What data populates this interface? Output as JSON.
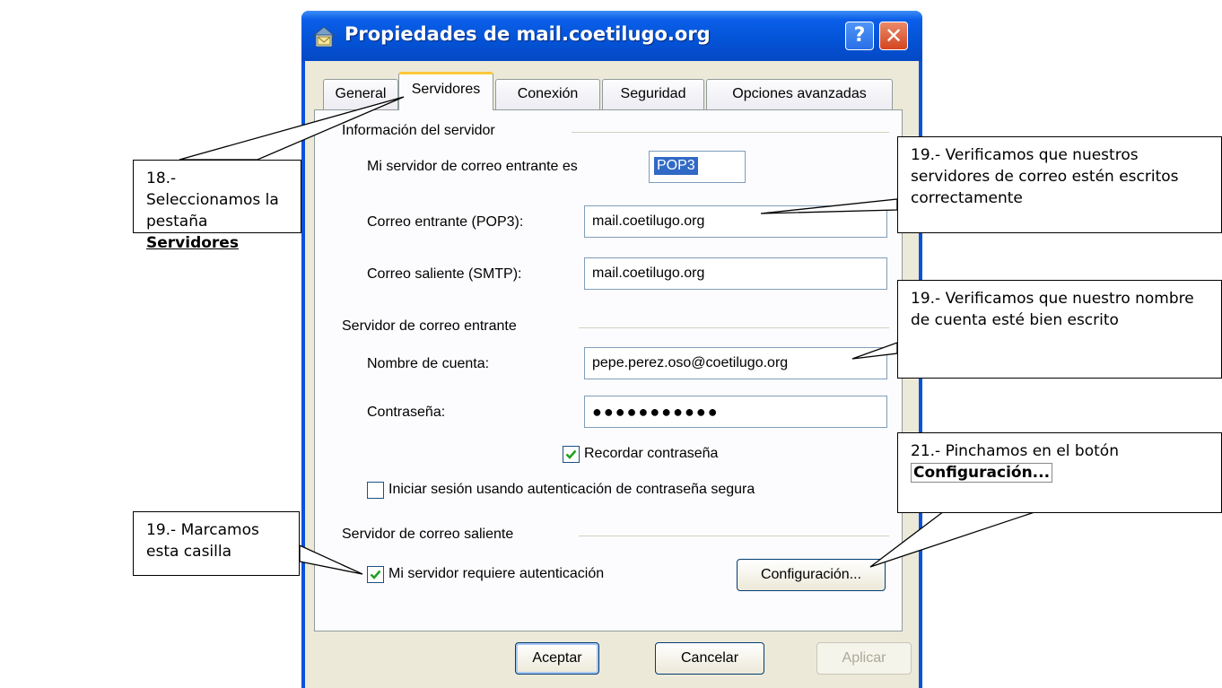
{
  "window": {
    "title": "Propiedades de mail.coetilugo.org",
    "help_glyph": "?",
    "close_glyph": "✕"
  },
  "tabs": [
    {
      "label": "General",
      "active": false
    },
    {
      "label": "Servidores",
      "active": true
    },
    {
      "label": "Conexión",
      "active": false
    },
    {
      "label": "Seguridad",
      "active": false
    },
    {
      "label": "Opciones avanzadas",
      "active": false
    }
  ],
  "server_info": {
    "heading": "Información del servidor",
    "incoming_type_label": "Mi servidor de correo entrante es",
    "incoming_type_value": "POP3",
    "incoming_label": "Correo entrante (POP3):",
    "incoming_value": "mail.coetilugo.org",
    "outgoing_label": "Correo saliente (SMTP):",
    "outgoing_value": "mail.coetilugo.org"
  },
  "incoming_server": {
    "heading": "Servidor de correo entrante",
    "account_label": "Nombre de cuenta:",
    "account_value": "pepe.perez.oso@coetilugo.org",
    "password_label": "Contraseña:",
    "password_value": "●●●●●●●●●●●",
    "remember_label": "Recordar contraseña",
    "remember_checked": true,
    "spa_label": "Iniciar sesión usando autenticación de contraseña segura",
    "spa_checked": false
  },
  "outgoing_server": {
    "heading": "Servidor de correo saliente",
    "requires_auth_label": "Mi servidor requiere autenticación",
    "requires_auth_checked": true,
    "settings_button": "Configuración..."
  },
  "footer": {
    "ok": "Aceptar",
    "cancel": "Cancelar",
    "apply": "Aplicar"
  },
  "callouts": {
    "c18_text": "18.- Seleccionamos la pestaña ",
    "c18_bold": "Servidores",
    "c19a_text": "19.- Verificamos que nuestros servidores de correo estén escritos correctamente",
    "c19b_text": "19.- Verificamos que nuestro nombre de cuenta esté bien escrito",
    "c19c_text": "19.- Marcamos esta casilla",
    "c21_text": "21.- Pinchamos en el botón ",
    "c21_bold": "Configuración..."
  },
  "colors": {
    "title_bar": "#0453d6",
    "dialog_face": "#ece9d8",
    "active_tab_accent": "#ffc83c",
    "check_green": "#21a121"
  },
  "icons": [
    "mail-account-icon",
    "help-icon",
    "close-icon",
    "checkmark-icon"
  ]
}
